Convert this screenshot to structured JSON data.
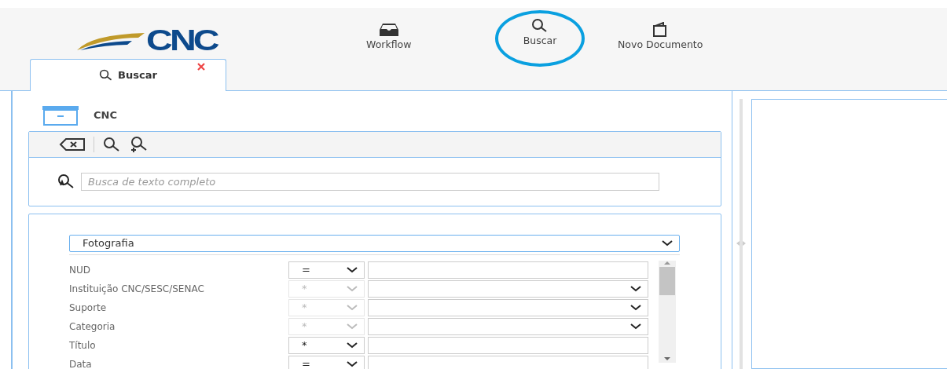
{
  "header": {
    "logo_text": "CNC",
    "nav": [
      {
        "label": "Workflow",
        "kind": "inbox",
        "highlighted": false
      },
      {
        "label": "Buscar",
        "kind": "search",
        "highlighted": true
      },
      {
        "label": "Novo Documento",
        "kind": "document",
        "highlighted": false
      }
    ]
  },
  "tabs": [
    {
      "label": "Buscar",
      "selected": true,
      "closable": true
    }
  ],
  "repository": {
    "name": "CNC"
  },
  "full_text_search": {
    "placeholder": "Busca de texto completo"
  },
  "document_type": {
    "value": "Fotografia"
  },
  "fields": [
    {
      "label": "NUD",
      "kind": "text",
      "operator": "=",
      "disabled": false
    },
    {
      "label": "Instituição CNC/SESC/SENAC",
      "kind": "select",
      "operator": "*",
      "disabled": true
    },
    {
      "label": "Suporte",
      "kind": "select",
      "operator": "*",
      "disabled": true
    },
    {
      "label": "Categoria",
      "kind": "select",
      "operator": "*",
      "disabled": true
    },
    {
      "label": "Título",
      "kind": "text",
      "operator": "*",
      "disabled": false
    },
    {
      "label": "Data",
      "kind": "text",
      "operator": "=",
      "disabled": false
    }
  ]
}
